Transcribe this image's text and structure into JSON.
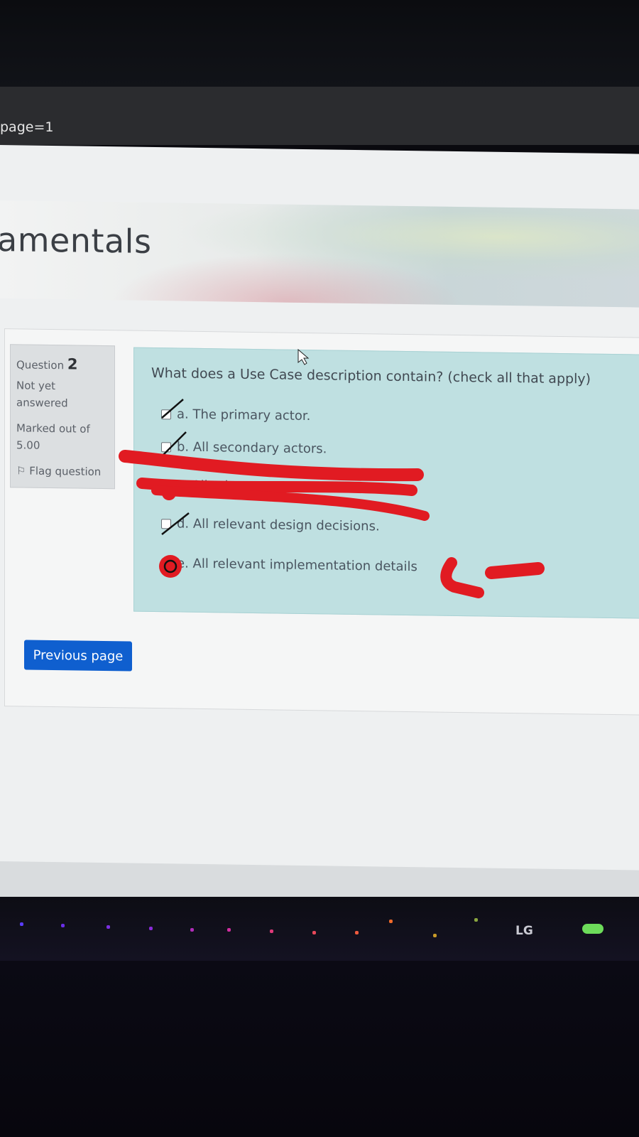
{
  "browser": {
    "url_fragment": "page=1"
  },
  "course": {
    "title_fragment": "amentals"
  },
  "question_info": {
    "question_label": "Question",
    "question_number": "2",
    "status_line1": "Not yet",
    "status_line2": "answered",
    "marked_line1": "Marked out of",
    "marked_line2": "5.00",
    "flag_label": "Flag question"
  },
  "question": {
    "text": "What does a Use Case description contain? (check all that apply)",
    "options": [
      {
        "label": "a. The primary actor."
      },
      {
        "label": "b. All secondary actors."
      },
      {
        "label": "c. All relevant"
      },
      {
        "label": "d. All relevant design decisions."
      },
      {
        "label": "e. All relevant implementation details"
      }
    ]
  },
  "navigation": {
    "previous_label": "Previous page"
  },
  "monitor": {
    "brand": "LG"
  },
  "colors": {
    "question_bg": "#bfe0e1",
    "button_bg": "#0f5fcf",
    "annotation_red": "#e11b22"
  }
}
